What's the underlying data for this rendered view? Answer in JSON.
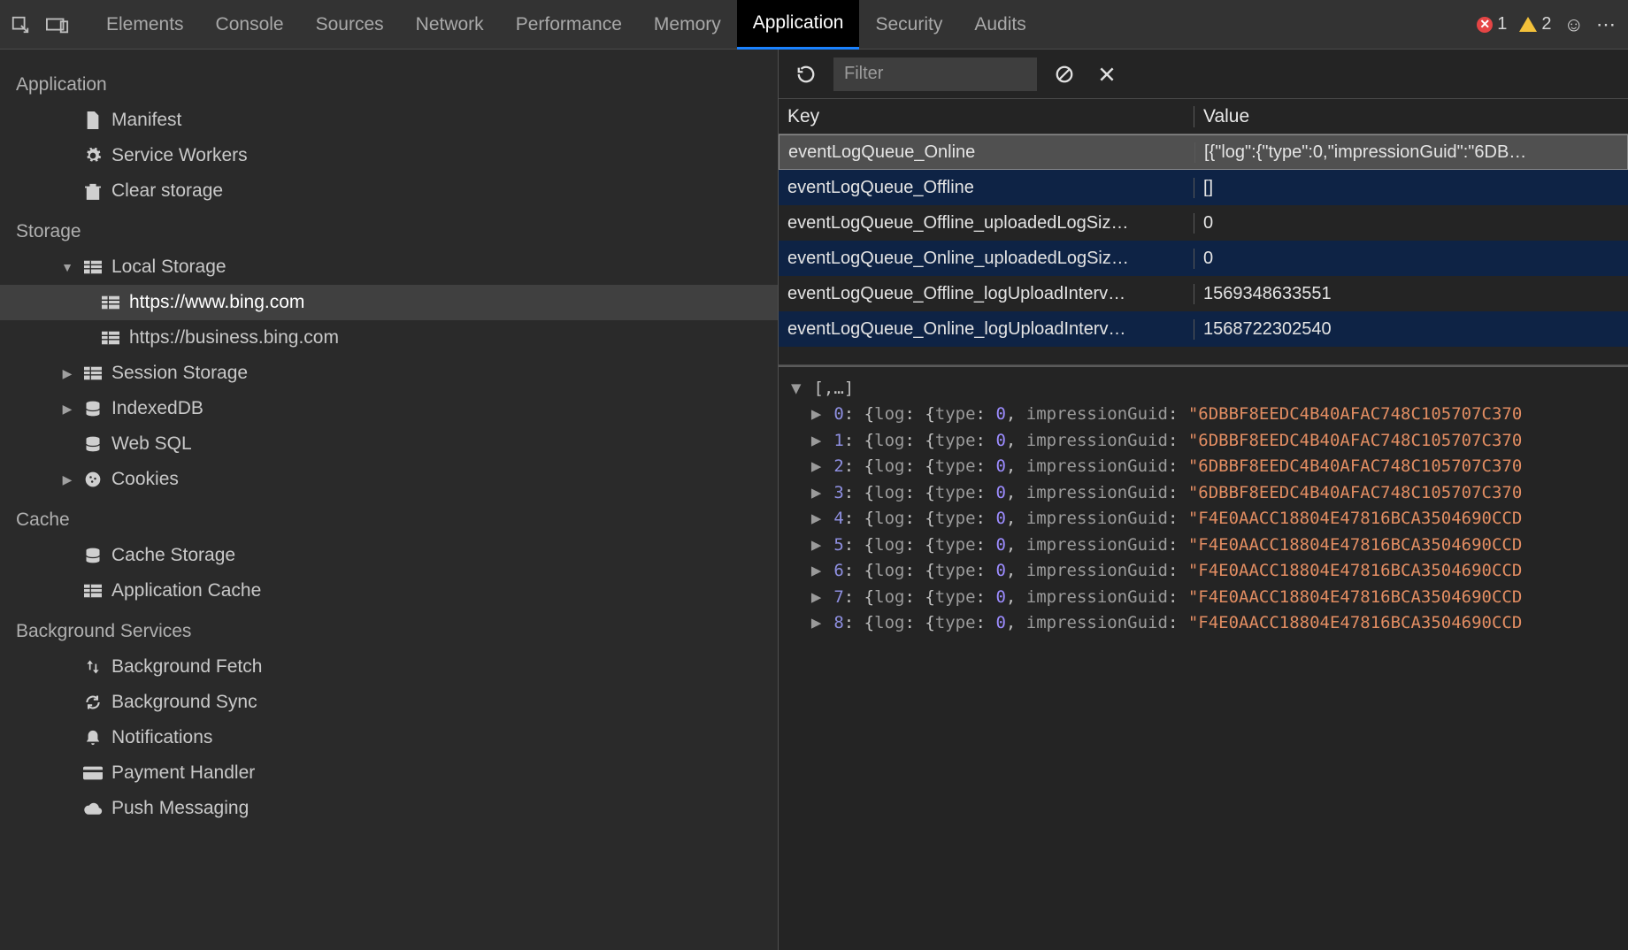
{
  "top": {
    "tabs": [
      "Elements",
      "Console",
      "Sources",
      "Network",
      "Performance",
      "Memory",
      "Application",
      "Security",
      "Audits"
    ],
    "active_tab": "Application",
    "errors": "1",
    "warnings": "2"
  },
  "sidebar": {
    "sections": [
      {
        "title": "Application",
        "items": [
          {
            "icon": "file",
            "label": "Manifest"
          },
          {
            "icon": "gear",
            "label": "Service Workers"
          },
          {
            "icon": "trash",
            "label": "Clear storage"
          }
        ]
      },
      {
        "title": "Storage",
        "items": [
          {
            "icon": "db-grid",
            "label": "Local Storage",
            "twist": "down",
            "children": [
              {
                "icon": "db-grid",
                "label": "https://www.bing.com",
                "selected": true
              },
              {
                "icon": "db-grid",
                "label": "https://business.bing.com"
              }
            ]
          },
          {
            "icon": "db-grid",
            "label": "Session Storage",
            "twist": "right"
          },
          {
            "icon": "db",
            "label": "IndexedDB",
            "twist": "right"
          },
          {
            "icon": "db",
            "label": "Web SQL"
          },
          {
            "icon": "cookie",
            "label": "Cookies",
            "twist": "right"
          }
        ]
      },
      {
        "title": "Cache",
        "items": [
          {
            "icon": "db",
            "label": "Cache Storage"
          },
          {
            "icon": "db-grid",
            "label": "Application Cache"
          }
        ]
      },
      {
        "title": "Background Services",
        "items": [
          {
            "icon": "updown",
            "label": "Background Fetch"
          },
          {
            "icon": "sync",
            "label": "Background Sync"
          },
          {
            "icon": "bell",
            "label": "Notifications"
          },
          {
            "icon": "card",
            "label": "Payment Handler"
          },
          {
            "icon": "cloud",
            "label": "Push Messaging"
          }
        ]
      }
    ]
  },
  "toolbar": {
    "filter_placeholder": "Filter"
  },
  "table": {
    "head_key": "Key",
    "head_value": "Value",
    "rows": [
      {
        "key": "eventLogQueue_Online",
        "value": "[{\"log\":{\"type\":0,\"impressionGuid\":\"6DB…",
        "selected": true,
        "alt": false
      },
      {
        "key": "eventLogQueue_Offline",
        "value": "[]",
        "alt": true
      },
      {
        "key": "eventLogQueue_Offline_uploadedLogSiz…",
        "value": "0",
        "alt": false
      },
      {
        "key": "eventLogQueue_Online_uploadedLogSiz…",
        "value": "0",
        "alt": true
      },
      {
        "key": "eventLogQueue_Offline_logUploadInterv…",
        "value": "1569348633551",
        "alt": false
      },
      {
        "key": "eventLogQueue_Online_logUploadInterv…",
        "value": "1568722302540",
        "alt": true
      }
    ]
  },
  "viewer": {
    "root_label": "[,…]",
    "entries": [
      {
        "idx": "0",
        "guid": "6DBBF8EEDC4B40AFAC748C105707C370"
      },
      {
        "idx": "1",
        "guid": "6DBBF8EEDC4B40AFAC748C105707C370"
      },
      {
        "idx": "2",
        "guid": "6DBBF8EEDC4B40AFAC748C105707C370"
      },
      {
        "idx": "3",
        "guid": "6DBBF8EEDC4B40AFAC748C105707C370"
      },
      {
        "idx": "4",
        "guid": "F4E0AACC18804E47816BCA3504690CCD"
      },
      {
        "idx": "5",
        "guid": "F4E0AACC18804E47816BCA3504690CCD"
      },
      {
        "idx": "6",
        "guid": "F4E0AACC18804E47816BCA3504690CCD"
      },
      {
        "idx": "7",
        "guid": "F4E0AACC18804E47816BCA3504690CCD"
      },
      {
        "idx": "8",
        "guid": "F4E0AACC18804E47816BCA3504690CCD"
      }
    ]
  }
}
